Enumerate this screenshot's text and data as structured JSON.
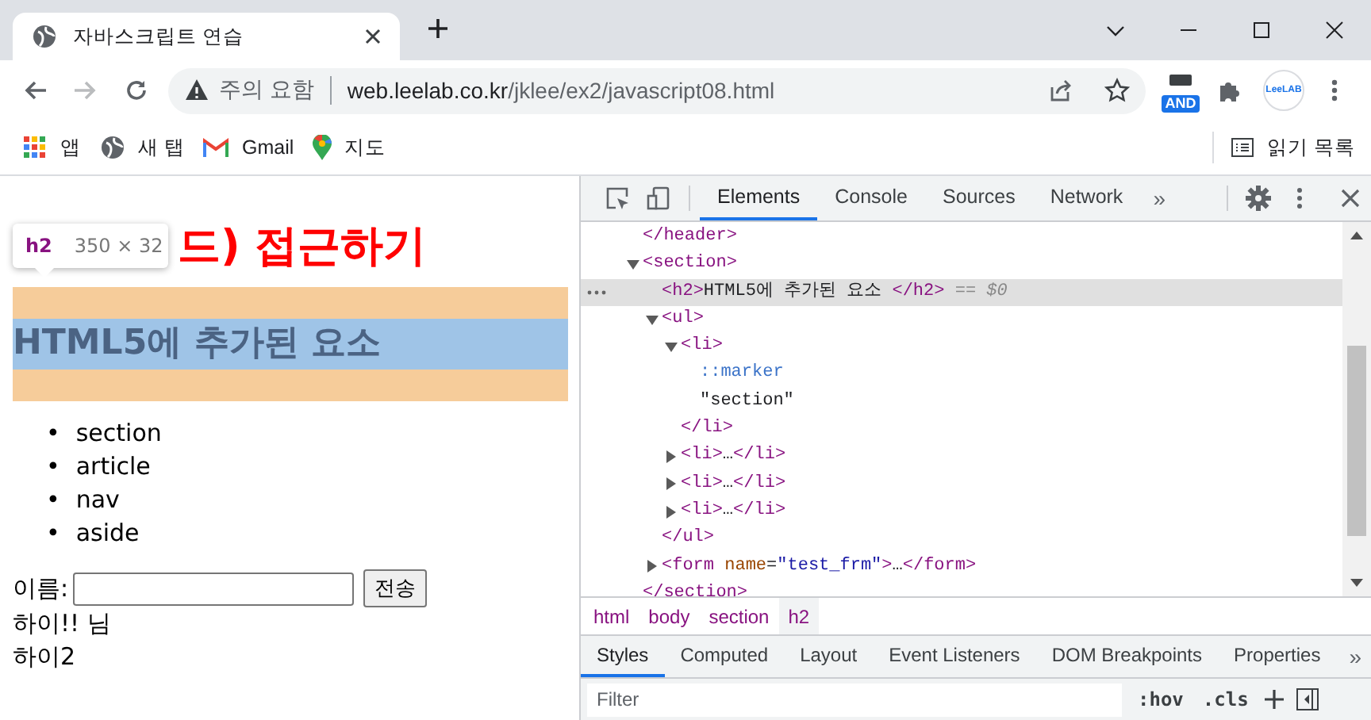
{
  "browser": {
    "tabs": [
      {
        "title": "자바스크립트 연습",
        "selected": true
      }
    ],
    "address": {
      "security_label": "주의 요함",
      "domain": "web.leelab.co.kr",
      "path": "/jklee/ex2/javascript08.html"
    },
    "extension_badge": "AND",
    "profile_label": "LeeLAB",
    "bookmarks": [
      {
        "label": "앱",
        "kind": "apps"
      },
      {
        "label": "새 탭",
        "kind": "globe"
      },
      {
        "label": "Gmail",
        "kind": "gmail"
      },
      {
        "label": "지도",
        "kind": "maps"
      }
    ],
    "reading_list": "읽기 목록"
  },
  "page": {
    "heading": "드) 접근하기",
    "inspect_tooltip": {
      "tag": "h2",
      "size": "350 × 32"
    },
    "subheading": {
      "text": "HTML5에 추가된 요소",
      "inspected": true
    },
    "list_marker": "•",
    "list": [
      "section",
      "article",
      "nav",
      "aside"
    ],
    "form": {
      "label": "이름:",
      "button": "전송"
    },
    "lines": [
      "하이!! 님",
      "하이2"
    ]
  },
  "devtools": {
    "tabs": [
      {
        "label": "Elements",
        "selected": true
      },
      {
        "label": "Console",
        "selected": false
      },
      {
        "label": "Sources",
        "selected": false
      },
      {
        "label": "Network",
        "selected": false
      }
    ],
    "tabs_overflow": "»",
    "dom": [
      {
        "text": "</header>",
        "selected": false
      },
      {
        "text": "<section>",
        "selected": false,
        "expanded": true,
        "closing": "</section>",
        "children": [
          {
            "text": "<h2>HTML5에 추가된 요소 </h2>",
            "suffix": "== $0",
            "selected": true
          },
          {
            "text": "<ul>",
            "selected": false,
            "expanded": true,
            "closing": "</ul>",
            "children": [
              {
                "text": "<li>",
                "selected": false,
                "expanded": true,
                "closing": "</li>",
                "children": [
                  {
                    "text": "::marker",
                    "selected": false
                  },
                  {
                    "text": "\"section\"",
                    "selected": false
                  }
                ]
              },
              {
                "text": "<li>…</li>",
                "selected": false,
                "expanded": false
              },
              {
                "text": "<li>…</li>",
                "selected": false,
                "expanded": false
              },
              {
                "text": "<li>…</li>",
                "selected": false,
                "expanded": false
              }
            ]
          },
          {
            "text": "<form name=\"test_frm\">…</form>",
            "selected": false,
            "expanded": false
          }
        ]
      }
    ],
    "breadcrumbs": [
      {
        "label": "html",
        "selected": false
      },
      {
        "label": "body",
        "selected": false
      },
      {
        "label": "section",
        "selected": false
      },
      {
        "label": "h2",
        "selected": true
      }
    ],
    "style_tabs": [
      {
        "label": "Styles",
        "selected": true
      },
      {
        "label": "Computed",
        "selected": false
      },
      {
        "label": "Layout",
        "selected": false
      },
      {
        "label": "Event Listeners",
        "selected": false
      },
      {
        "label": "DOM Breakpoints",
        "selected": false
      },
      {
        "label": "Properties",
        "selected": false
      }
    ],
    "style_tabs_overflow": "»",
    "filter": {
      "placeholder": "Filter"
    },
    "hov": ":hov",
    "cls": ".cls"
  }
}
